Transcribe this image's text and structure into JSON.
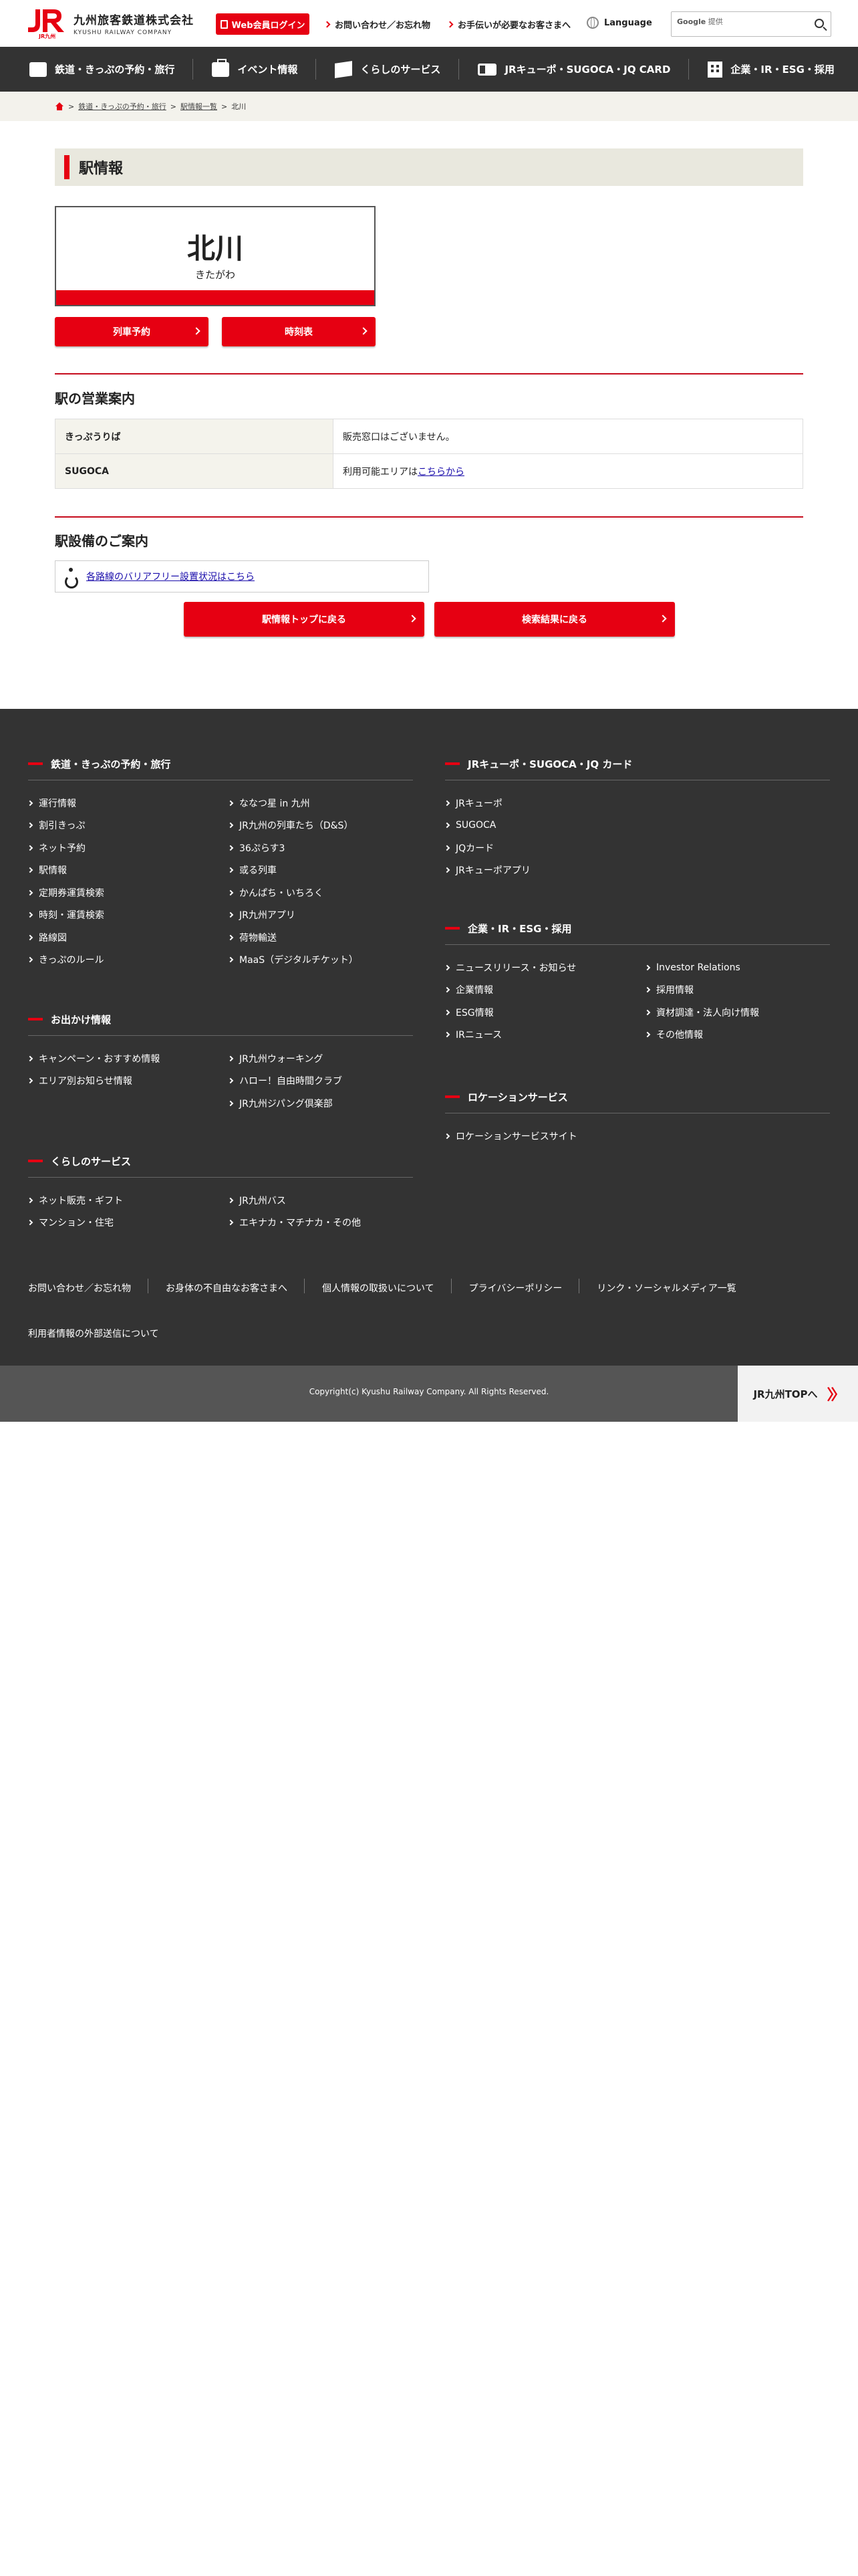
{
  "header": {
    "logo_jp": "九州旅客鉄道株式会社",
    "logo_en": "KYUSHU RAILWAY COMPANY",
    "logo_mark_text": "JR九州",
    "login": "Web会員ログイン",
    "contact": "お問い合わせ／お忘れ物",
    "assistance": "お手伝いが必要なお客さまへ",
    "language": "Language",
    "search_brand": "Google",
    "search_placeholder": "提供"
  },
  "nav": [
    {
      "label": "鉄道・きっぷの予約・旅行",
      "icon": "train-icon"
    },
    {
      "label": "イベント情報",
      "icon": "bag-icon"
    },
    {
      "label": "くらしのサービス",
      "icon": "box-icon"
    },
    {
      "label": "JRキューポ・SUGOCA・JQ CARD",
      "icon": "card-icon"
    },
    {
      "label": "企業・IR・ESG・採用",
      "icon": "building-icon"
    }
  ],
  "breadcrumb": [
    "鉄道・きっぷの予約・旅行",
    "駅情報一覧",
    "北川"
  ],
  "page_title": "駅情報",
  "station": {
    "name": "北川",
    "kana": "きたがわ"
  },
  "buttons": {
    "reserve": "列車予約",
    "timetable": "時刻表",
    "back_top": "駅情報トップに戻る",
    "back_results": "検索結果に戻る"
  },
  "sales": {
    "title": "駅の営業案内",
    "rows": [
      {
        "label": "きっぷうりば",
        "value": "販売窓口はございません。",
        "link": ""
      },
      {
        "label": "SUGOCA",
        "value": "利用可能エリアは",
        "link": "こちらから"
      }
    ]
  },
  "facilities": {
    "title": "駅設備のご案内",
    "barrier_free": "各路線のバリアフリー設置状況はこちら"
  },
  "footer": {
    "rail": {
      "title": "鉄道・きっぷの予約・旅行",
      "col1": [
        "運行情報",
        "割引きっぷ",
        "ネット予約",
        "駅情報",
        "定期券運賃検索",
        "時刻・運賃検索",
        "路線図",
        "きっぷのルール"
      ],
      "col2": [
        "ななつ星 in 九州",
        "JR九州の列車たち（D&S）",
        "36ぷらす3",
        "或る列車",
        "かんぱち・いちろく",
        "JR九州アプリ",
        "荷物輸送",
        "MaaS（デジタルチケット）"
      ]
    },
    "outing": {
      "title": "お出かけ情報",
      "col1": [
        "キャンペーン・おすすめ情報",
        "エリア別お知らせ情報"
      ],
      "col2": [
        "JR九州ウォーキング",
        "ハロー！自由時間クラブ",
        "JR九州ジパング倶楽部"
      ]
    },
    "living": {
      "title": "くらしのサービス",
      "col1": [
        "ネット販売・ギフト",
        "マンション・住宅"
      ],
      "col2": [
        "JR九州バス",
        "エキナカ・マチナカ・その他"
      ]
    },
    "card": {
      "title": "JRキューポ・SUGOCA・JQ カード",
      "col1": [
        "JRキューポ",
        "SUGOCA",
        "JQカード",
        "JRキューポアプリ"
      ]
    },
    "corp": {
      "title": "企業・IR・ESG・採用",
      "col1": [
        "ニュースリリース・お知らせ",
        "企業情報",
        "ESG情報",
        "IRニュース"
      ],
      "col2": [
        "Investor Relations",
        "採用情報",
        "資材調達・法人向け情報",
        "その他情報"
      ]
    },
    "location": {
      "title": "ロケーションサービス",
      "col1": [
        "ロケーションサービスサイト"
      ]
    },
    "bottom_links": [
      "お問い合わせ／お忘れ物",
      "お身体の不自由なお客さまへ",
      "個人情報の取扱いについて",
      "プライバシーポリシー",
      "リンク・ソーシャルメディア一覧"
    ],
    "bottom_link2": "利用者情報の外部送信について",
    "copyright": "Copyright(c) Kyushu Railway Company. All Rights Reserved.",
    "top_button": "JR九州TOPへ"
  },
  "colors": {
    "brand_red": "#e60012",
    "nav_bg": "#333333",
    "crumb_bg": "#f3f2ec"
  }
}
